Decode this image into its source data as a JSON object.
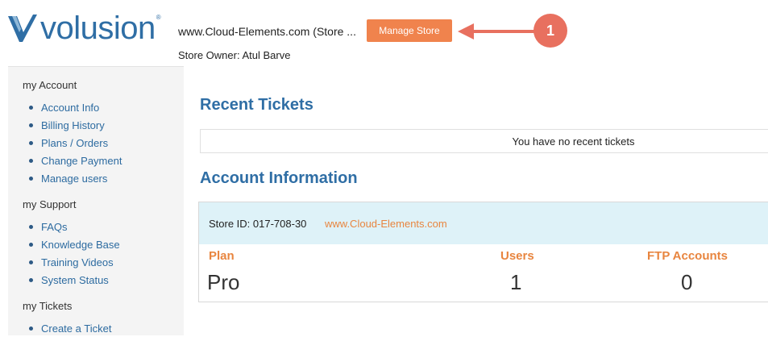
{
  "header": {
    "logo_text": "volusion",
    "logo_reg": "®",
    "store_url": "www.Cloud-Elements.com (Store ...",
    "manage_store_label": "Manage Store",
    "store_owner": "Store Owner: Atul Barve",
    "step_number": "1"
  },
  "sidebar": {
    "sections": [
      {
        "title": "my Account",
        "items": [
          "Account Info",
          "Billing History",
          "Plans / Orders",
          "Change Payment",
          "Manage users"
        ]
      },
      {
        "title": "my Support",
        "items": [
          "FAQs",
          "Knowledge Base",
          "Training Videos",
          "System Status"
        ]
      },
      {
        "title": "my Tickets",
        "items": [
          "Create a Ticket"
        ]
      }
    ]
  },
  "main": {
    "recent_tickets_title": "Recent Tickets",
    "no_tickets_text": "You have no recent tickets",
    "account_info_title": "Account Information",
    "store_id": "Store ID: 017-708-30",
    "store_link": "www.Cloud-Elements.com",
    "columns": [
      {
        "label": "Plan",
        "value": "Pro"
      },
      {
        "label": "Users",
        "value": "1"
      },
      {
        "label": "FTP Accounts",
        "value": "0"
      }
    ]
  },
  "colors": {
    "accent_orange": "#f0834d",
    "link_blue": "#2d6ba0",
    "brand_blue": "#2f6ea5",
    "badge_red": "#e8705f",
    "info_band": "#def2f8"
  }
}
